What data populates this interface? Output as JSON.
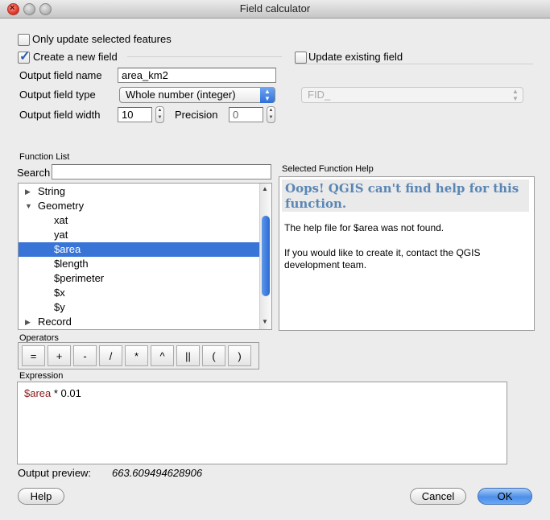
{
  "window": {
    "title": "Field calculator"
  },
  "options": {
    "only_update_selected": "Only update selected features",
    "create_new_field": "Create a new field",
    "update_existing_field": "Update existing field"
  },
  "new_field": {
    "name_label": "Output field name",
    "name_value": "area_km2",
    "type_label": "Output field type",
    "type_value": "Whole number (integer)",
    "width_label": "Output field width",
    "width_value": "10",
    "precision_label": "Precision",
    "precision_value": "0"
  },
  "existing_field": {
    "selected": "FID_"
  },
  "function_list": {
    "title": "Function List",
    "search_label": "Search",
    "items": [
      {
        "label": "String",
        "kind": "group",
        "expanded": false
      },
      {
        "label": "Geometry",
        "kind": "group",
        "expanded": true
      },
      {
        "label": "xat",
        "kind": "child"
      },
      {
        "label": "yat",
        "kind": "child"
      },
      {
        "label": "$area",
        "kind": "child",
        "selected": true
      },
      {
        "label": "$length",
        "kind": "child"
      },
      {
        "label": "$perimeter",
        "kind": "child"
      },
      {
        "label": "$x",
        "kind": "child"
      },
      {
        "label": "$y",
        "kind": "child"
      },
      {
        "label": "Record",
        "kind": "group",
        "expanded": false
      }
    ]
  },
  "help": {
    "title": "Selected Function Help",
    "heading": "Oops! QGIS can't find help for this function.",
    "line1": "The help file for $area was not found.",
    "line2": "If you would like to create it, contact the QGIS development team."
  },
  "operators": {
    "title": "Operators",
    "buttons": [
      "=",
      "+",
      "-",
      "/",
      "*",
      "^",
      "||",
      "(",
      ")"
    ]
  },
  "expression": {
    "title": "Expression",
    "field": "$area",
    "rest": " * 0.01"
  },
  "preview": {
    "label": "Output preview:",
    "value": "663.609494628906"
  },
  "buttons": {
    "help": "Help",
    "cancel": "Cancel",
    "ok": "OK"
  },
  "colors": {
    "selection": "#3875d7",
    "help_heading": "#5a86b5",
    "field_ref": "#8b1a1a"
  }
}
